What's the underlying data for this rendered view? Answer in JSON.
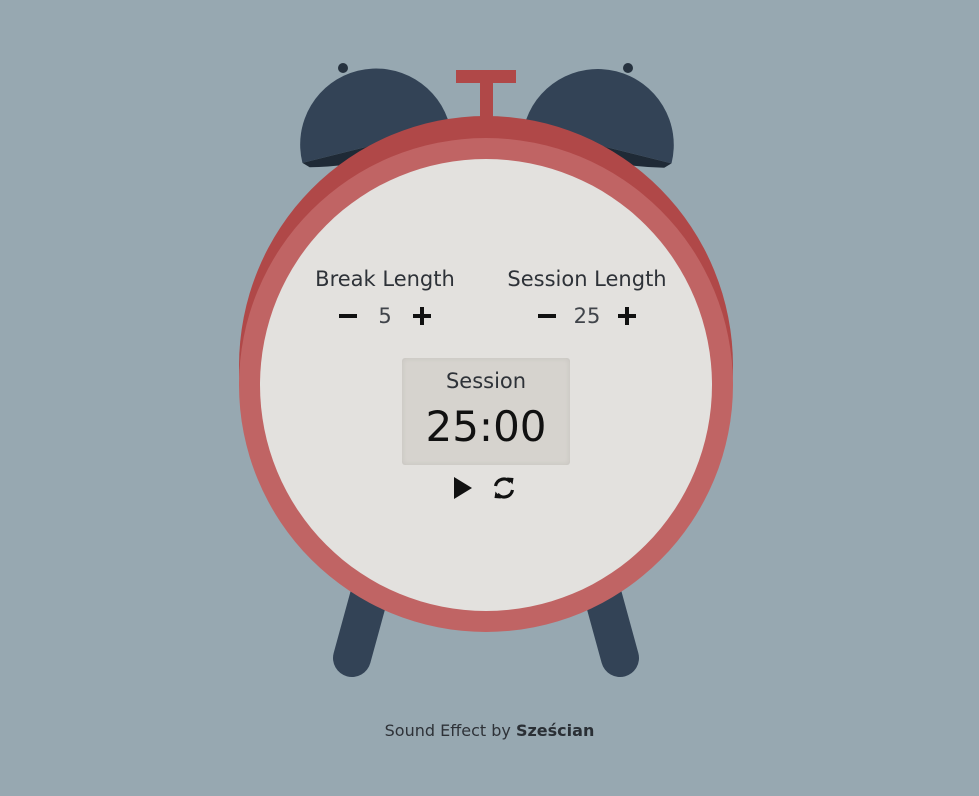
{
  "break": {
    "title": "Break Length",
    "value": "5",
    "decrement_icon": "minus-icon",
    "increment_icon": "plus-icon"
  },
  "session": {
    "title": "Session Length",
    "value": "25",
    "decrement_icon": "minus-icon",
    "increment_icon": "plus-icon"
  },
  "timer": {
    "mode_label": "Session",
    "time": "25:00"
  },
  "controls": {
    "play_icon": "play-icon",
    "reset_icon": "refresh-icon"
  },
  "footer": {
    "prefix": "Sound Effect by",
    "author": "Sześcian"
  },
  "colors": {
    "background": "#97a8b1",
    "clock_rim": "#c06464",
    "clock_rim_dark": "#b04848",
    "clock_face": "#e3e1de",
    "bells": "#334356",
    "display_bg": "#d6d3ce"
  }
}
